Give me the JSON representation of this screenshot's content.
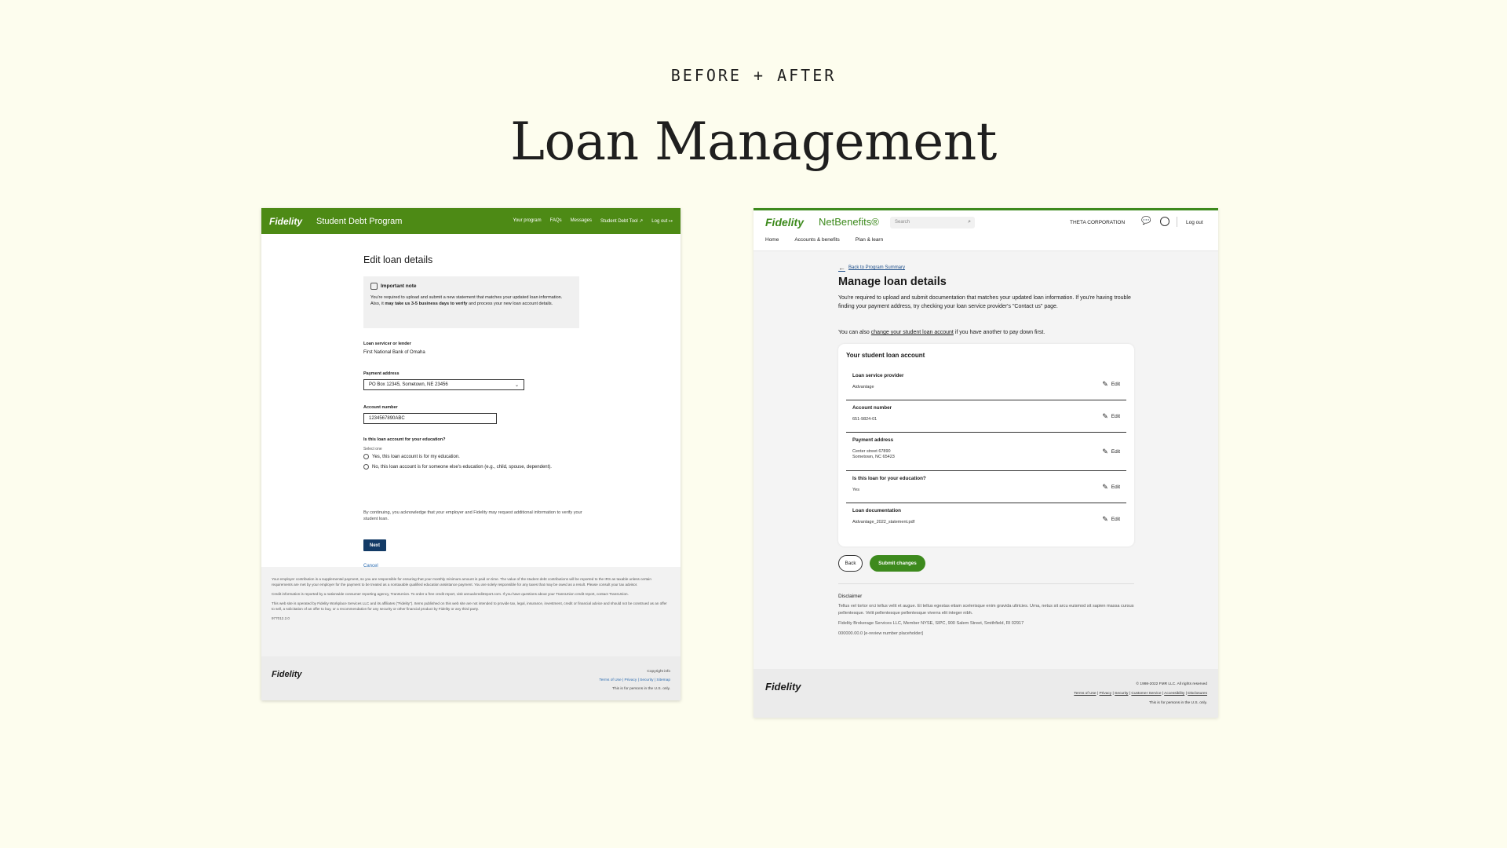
{
  "slide": {
    "eyebrow": "BEFORE + AFTER",
    "title": "Loan Management"
  },
  "before": {
    "header": {
      "logo": "Fidelity",
      "program": "Student Debt Program",
      "nav": [
        "Your program",
        "FAQs",
        "Messages",
        "Student Debt Tool ↗",
        "Log out ↦"
      ]
    },
    "title": "Edit loan details",
    "note": {
      "title": "Important note",
      "text_a": "You're required to upload and submit a new statement that matches your updated loan information. Also, it ",
      "text_bold": "may take us 3-5 business days to verify",
      "text_b": " and process your new loan account details."
    },
    "servicer_label": "Loan servicer or lender",
    "servicer_value": "First National Bank of Omaha",
    "address_label": "Payment address",
    "address_value": "PO Box 12345, Sometown, NE 23456",
    "account_label": "Account number",
    "account_value": "1234567890ABC",
    "education_label": "Is this loan account for your education?",
    "select_one": "Select one",
    "radio_yes": "Yes, this loan account is for my education.",
    "radio_no": "No, this loan account is for someone else's education (e.g., child, spouse, dependent).",
    "ack": "By continuing, you acknowledge that your employer and Fidelity may request additional information to verify your student loan.",
    "next": "Next",
    "cancel": "Cancel",
    "disclaimer": [
      "Your employer contribution is a supplemental payment, so you are responsible for ensuring that your monthly minimum amount is paid on time. The value of the student debt contributions will be reported to the IRS as taxable unless certain requirements are met by your employer for the payment to be treated as a nontaxable qualified education assistance payment. You are solely responsible for any taxes that may be owed as a result. Please consult your tax advisor.",
      "Credit information is reported by a nationwide consumer reporting agency, TransUnion. To order a free credit report, visit annualcreditreport.com. If you have questions about your TransUnion credit report, contact TransUnion.",
      "This web site is operated by Fidelity Workplace Services LLC and its affiliates (\"Fidelity\"). Items published on this web site are not intended to provide tax, legal, insurance, investment, credit or financial advice and should not be construed as an offer to sell, a solicitation of an offer to buy, or a recommendation for any security or other financial product by Fidelity or any third party.",
      "977012.2.0"
    ],
    "footer": {
      "logo": "Fidelity",
      "copyright": "Copyright info",
      "links": "Terms of Use | Privacy | Security | Sitemap",
      "note": "This is for persons in the U.S. only."
    }
  },
  "after": {
    "header": {
      "logo": "Fidelity",
      "brand": "NetBenefits®",
      "search_placeholder": "Search",
      "corporation": "THETA CORPORATION",
      "logout": "Log out",
      "nav": [
        "Home",
        "Accounts & benefits",
        "Plan & learn"
      ]
    },
    "back_link": "Back to Program Summary",
    "title": "Manage loan details",
    "intro": "You're required to upload and submit documentation that matches your updated loan information. If you're having trouble finding your payment address, try checking your loan service provider's \"Contact us\" page.",
    "intro2_a": "You can also ",
    "intro2_link": "change your student loan account",
    "intro2_b": " if you have another to pay down first.",
    "card": {
      "title": "Your student loan account",
      "edit_label": "Edit",
      "rows": [
        {
          "label": "Loan service provider",
          "value": "Aidvantage"
        },
        {
          "label": "Account number",
          "value": "651-9824-01"
        },
        {
          "label": "Payment address",
          "value": "Center street 67890",
          "value2": "Sometown, NC 65423"
        },
        {
          "label": "Is this loan for your education?",
          "value": "Yes"
        },
        {
          "label": "Loan documentation",
          "value": "Aidvantage_2022_statement.pdf"
        }
      ]
    },
    "back_button": "Back",
    "submit_button": "Submit changes",
    "disclaimer": {
      "title": "Disclaimer",
      "text": "Tellus vel tortor orci tellus velit et augue. Et tellus egestas etiam scelerisque enim gravida ultricies. Urna, netus sit arcu euismod sit sapien massa cursus pellentesque. Velit pellentesque pellentesque viverra elit integer nibh.",
      "company": "Fidelity Brokerage Services LLC, Member NYSE, SIPC, 900 Salem Street, Smithfield, RI 02917",
      "review": "000000.00.0 [e-review number placeholder]"
    },
    "footer": {
      "logo": "Fidelity",
      "copyright": "© 1998-2022 FMR LLC. All rights reserved",
      "links": [
        "Terms of Use",
        "Privacy",
        "Security",
        "Customer Service",
        "Accessibility",
        "Disclosures"
      ],
      "note": "This is for persons in the U.S. only."
    }
  }
}
